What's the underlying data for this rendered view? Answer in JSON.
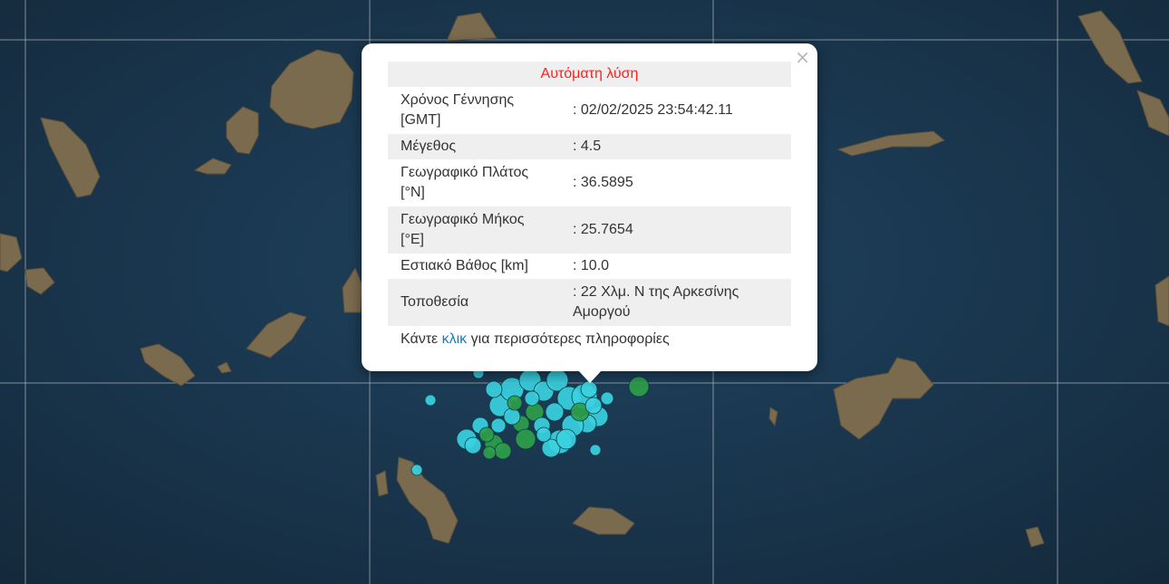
{
  "popup": {
    "title": "Αυτόματη λύση",
    "close_icon": "×",
    "rows": [
      {
        "label": "Χρόνος Γέννησης [GMT]",
        "value": ": 02/02/2025 23:54:42.11"
      },
      {
        "label": "Μέγεθος",
        "value": ": 4.5"
      },
      {
        "label": "Γεωγραφικό Πλάτος [°N]",
        "value": ": 36.5895"
      },
      {
        "label": "Γεωγραφικό Μήκος [°E]",
        "value": ": 25.7654"
      },
      {
        "label": "Εστιακό Βάθος [km]",
        "value": ": 10.0"
      },
      {
        "label": "Τοποθεσία",
        "value": ": 22 Χλμ. Ν της Αρκεσίνης Αμοργού"
      }
    ],
    "footer_prefix": "Κάντε ",
    "footer_link": "κλικ",
    "footer_suffix": " για περισσότερες πληροφορίες"
  },
  "colors": {
    "sea": "#1c3a52",
    "land": "#7a6a4e",
    "marker_cyan": "#3ad0e0",
    "marker_green": "#2e9e4a",
    "title_red": "#ff2020",
    "link_blue": "#1a7ab8"
  }
}
